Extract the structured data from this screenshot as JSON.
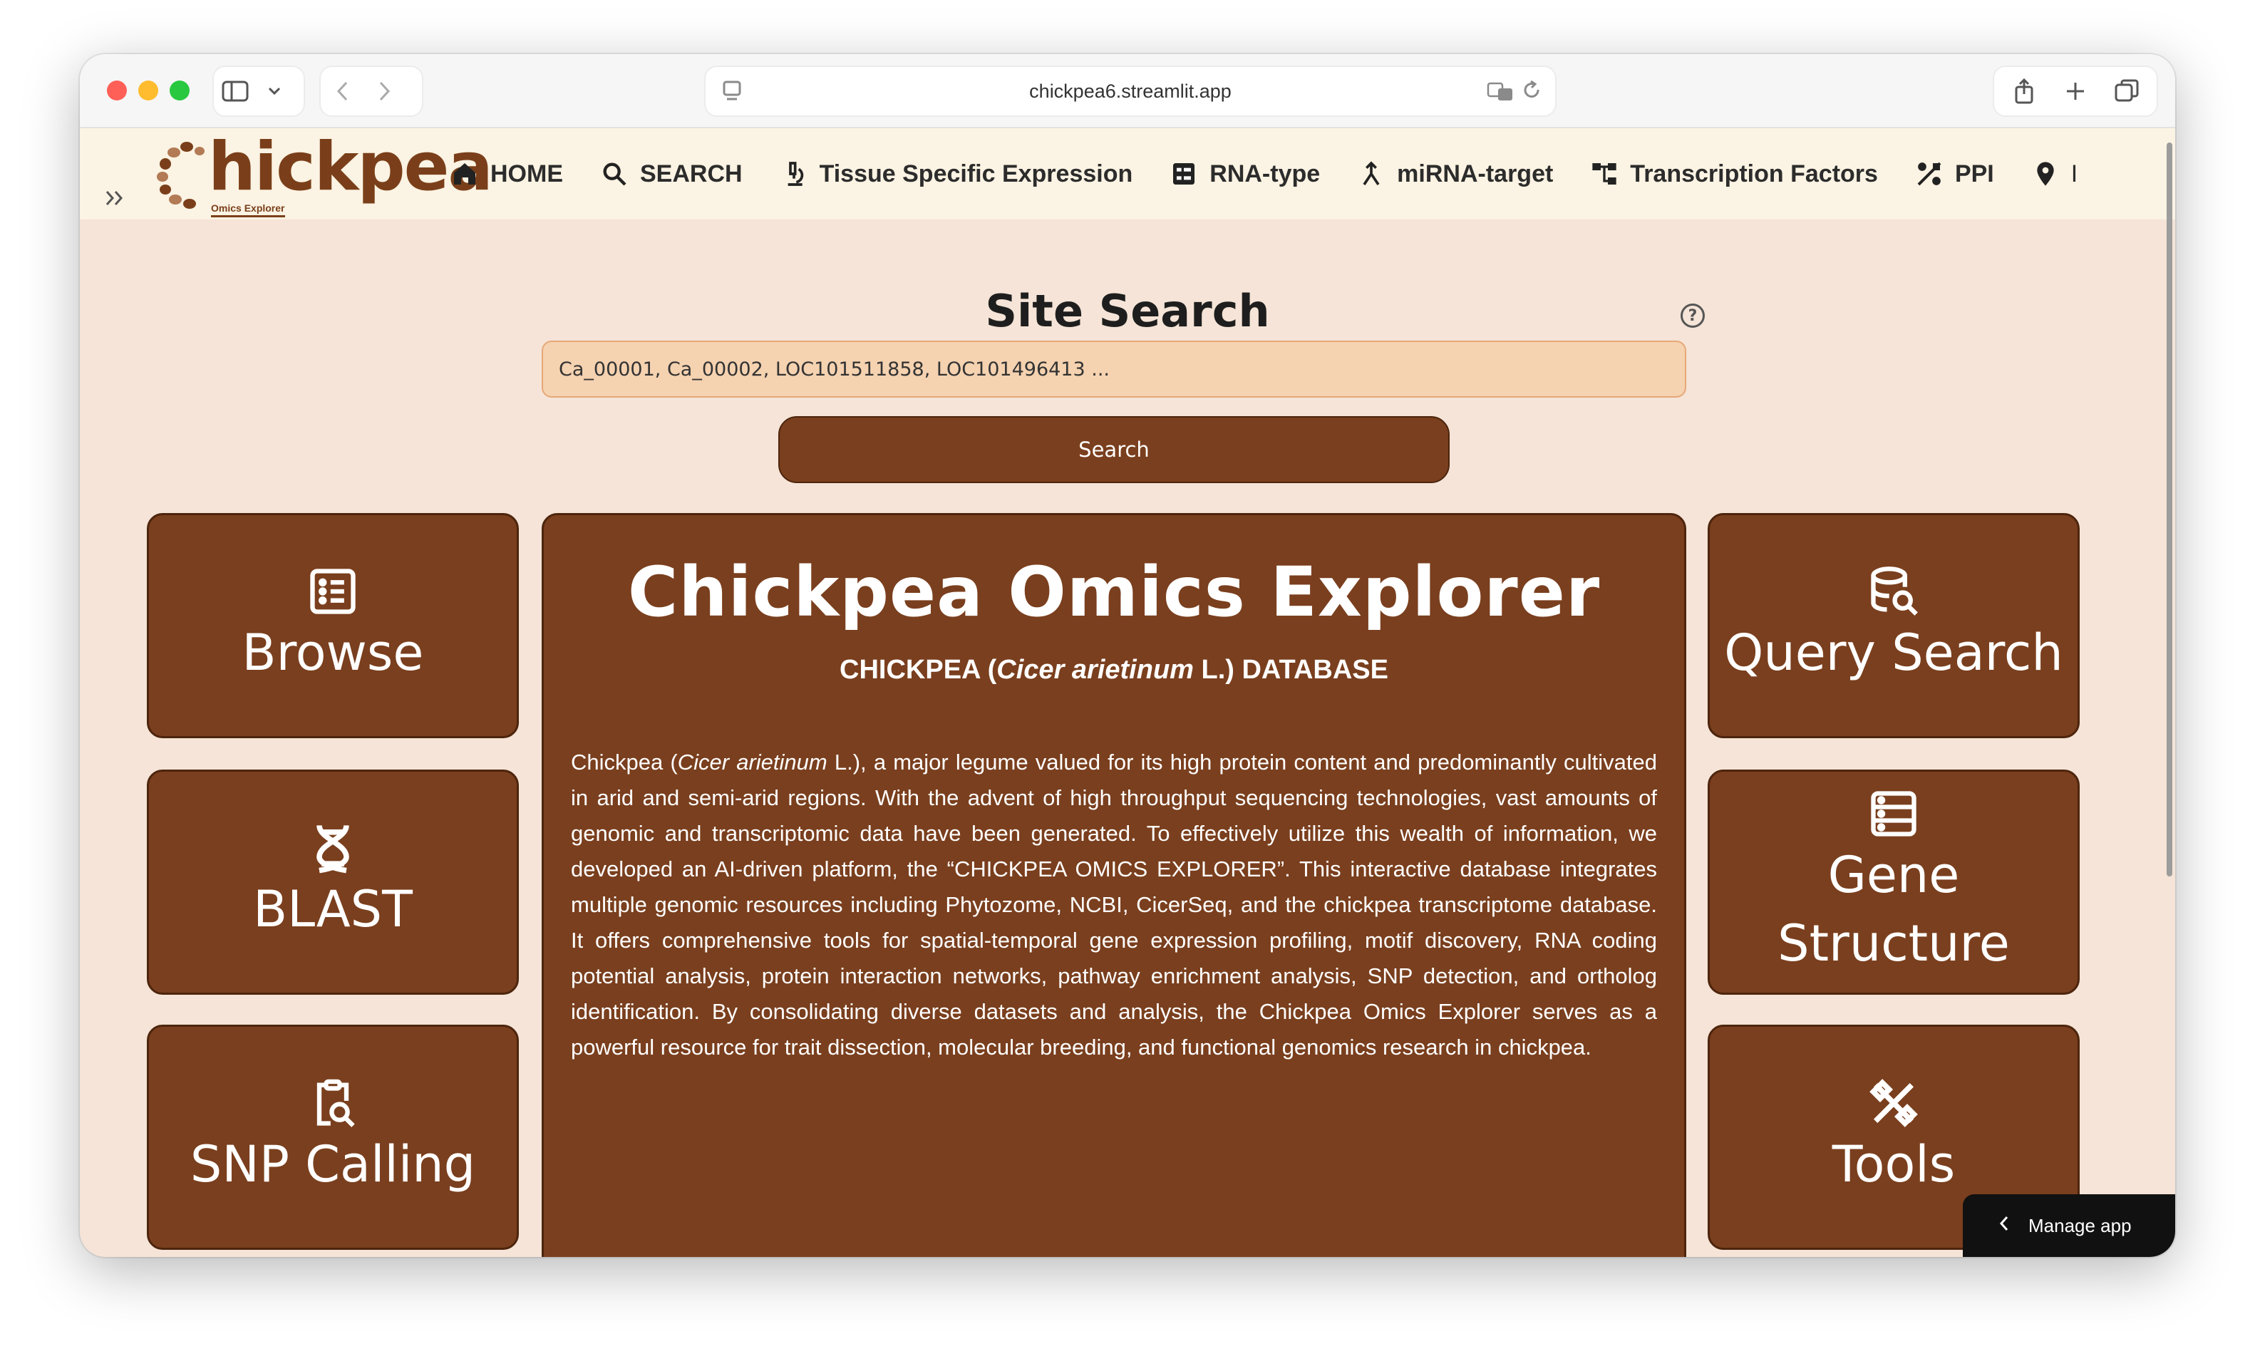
{
  "browser": {
    "url": "chickpea6.streamlit.app"
  },
  "nav": {
    "logo_text": "hickpea",
    "logo_subtitle": "Omics Explorer",
    "items": [
      {
        "label": "HOME",
        "icon": "home-icon"
      },
      {
        "label": "SEARCH",
        "icon": "search-icon"
      },
      {
        "label": "Tissue Specific Expression",
        "icon": "microscope-icon"
      },
      {
        "label": "RNA-type",
        "icon": "list-box-icon"
      },
      {
        "label": "miRNA-target",
        "icon": "merge-arrow-icon"
      },
      {
        "label": "Transcription Factors",
        "icon": "hierarchy-icon"
      },
      {
        "label": "PPI",
        "icon": "network-icon"
      },
      {
        "label": "I",
        "icon": "pin-icon"
      }
    ]
  },
  "search": {
    "title": "Site Search",
    "help": "?",
    "input_value": "Ca_00001, Ca_00002, LOC101511858, LOC101496413 ...",
    "button_label": "Search"
  },
  "tiles": {
    "browse": {
      "label": "Browse",
      "icon": "list-icon"
    },
    "blast": {
      "label": "BLAST",
      "icon": "dna-icon"
    },
    "snp": {
      "label": "SNP Calling",
      "icon": "clipboard-search-icon"
    },
    "query": {
      "label": "Query Search",
      "icon": "database-search-icon"
    },
    "gene": {
      "label": "Gene Structure",
      "icon": "server-icon"
    },
    "tools": {
      "label": "Tools",
      "icon": "tools-icon"
    }
  },
  "panel": {
    "title": "Chickpea Omics Explorer",
    "subtitle_pre": "CHICKPEA (",
    "subtitle_italic": "Cicer arietinum",
    "subtitle_post": " L.) DATABASE",
    "body_pre": "Chickpea (",
    "body_italic": "Cicer arietinum",
    "body_post": " L.), a major legume valued for its high protein content and predominantly cultivated in arid and semi-arid regions. With the advent of high throughput sequencing technologies, vast amounts of genomic and transcriptomic data have been generated. To effectively utilize this wealth of information, we developed an AI-driven platform, the “CHICKPEA OMICS EXPLORER”. This interactive database integrates multiple genomic resources including Phytozome, NCBI, CicerSeq, and the chickpea transcriptome database. It offers comprehensive tools for spatial-temporal gene expression profiling, motif discovery, RNA coding potential analysis, protein interaction networks, pathway enrichment analysis, SNP detection, and ortholog identification. By consolidating diverse datasets and analysis, the Chickpea Omics Explorer serves as a powerful resource for trait dissection, molecular breeding, and functional genomics research in chickpea."
  },
  "manage": {
    "label": "Manage app"
  },
  "colors": {
    "brown": "#7a3f1e",
    "page_bg": "#f5e4d7",
    "nav_bg": "#fbf3e3",
    "input_bg": "#f5d2b0"
  }
}
